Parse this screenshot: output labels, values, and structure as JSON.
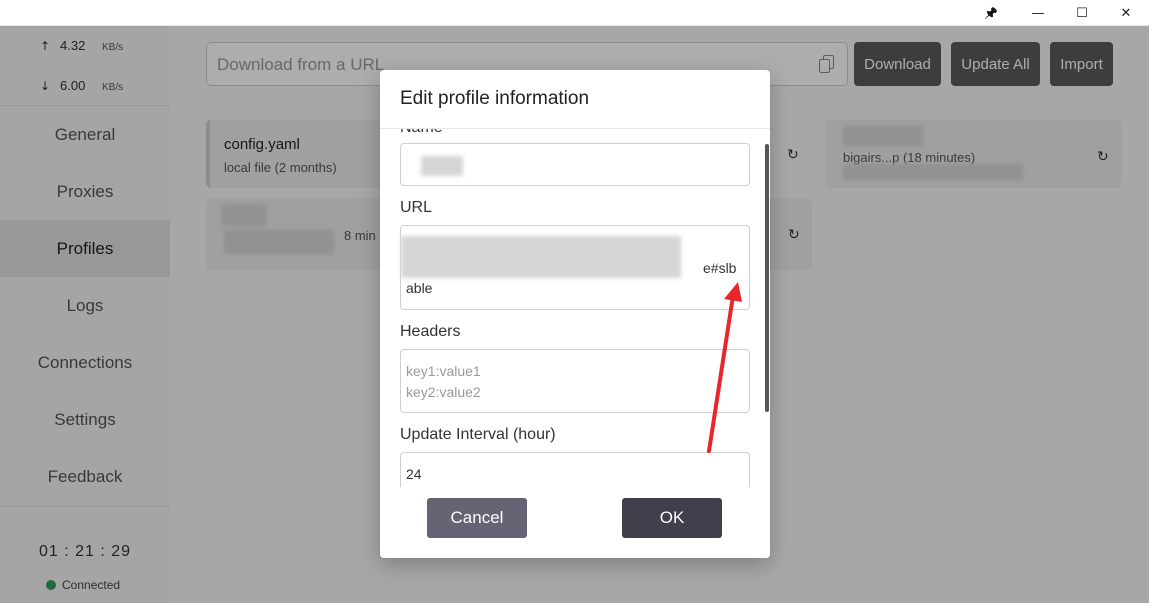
{
  "window": {
    "pin_glyph": "📌",
    "min_glyph": "—",
    "max_glyph": "☐",
    "close_glyph": "✕"
  },
  "sidebar": {
    "traffic": {
      "up_arrow": "↑",
      "up_value": "4.32",
      "up_unit": "KB/s",
      "down_arrow": "↓",
      "down_value": "6.00",
      "down_unit": "KB/s"
    },
    "items": [
      {
        "label": "General"
      },
      {
        "label": "Proxies"
      },
      {
        "label": "Profiles"
      },
      {
        "label": "Logs"
      },
      {
        "label": "Connections"
      },
      {
        "label": "Settings"
      },
      {
        "label": "Feedback"
      }
    ],
    "active_item": "Profiles",
    "clock": "01 : 21 : 29",
    "status": "Connected",
    "status_color": "#2e9e58"
  },
  "main": {
    "url_placeholder": "Download from a URL",
    "buttons": {
      "download": "Download",
      "update_all": "Update All",
      "import": "Import"
    },
    "cards": [
      {
        "title": "config.yaml",
        "subtitle": "local file (2 months)"
      },
      {
        "subtitle_fragment": "8 min"
      },
      {
        "subtitle_fragment": "bigairs...p (18 minutes)"
      }
    ],
    "refresh_glyph": "↻"
  },
  "dialog": {
    "title": "Edit profile information",
    "fields": {
      "name_label": "Name",
      "url_label": "URL",
      "url_value_end": "e#slb",
      "url_value_line2": "able",
      "headers_label": "Headers",
      "headers_placeholder_1": "key1:value1",
      "headers_placeholder_2": "key2:value2",
      "interval_label": "Update Interval (hour)",
      "interval_value": "24"
    },
    "cancel_label": "Cancel",
    "ok_label": "OK"
  },
  "colors": {
    "accent_dark": "#403f4c",
    "cancel": "#676274",
    "annotation_arrow": "#e8262b"
  }
}
